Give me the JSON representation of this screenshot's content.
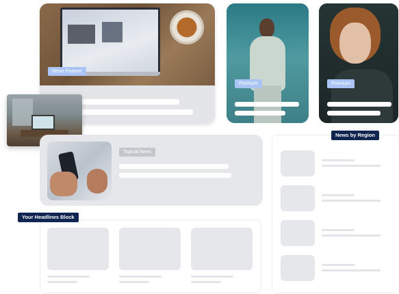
{
  "labels": {
    "news_feature": "News Feature",
    "premium_1": "Premium",
    "premium_2": "Premium",
    "topical_news": "Topical News",
    "news_by_region": "News by Region",
    "headlines_block": "Your Headlines Block"
  },
  "icons": {
    "feature": "laptop-desk-photo",
    "premium_1": "man-portrait-photo",
    "premium_2": "woman-portrait-photo",
    "topical": "phone-in-hand-photo",
    "overlay": "living-room-laptop-photo"
  },
  "colors": {
    "navy_tag": "#10254f",
    "light_tag": "#a9c4f5",
    "placeholder": "#e6e7ea"
  }
}
